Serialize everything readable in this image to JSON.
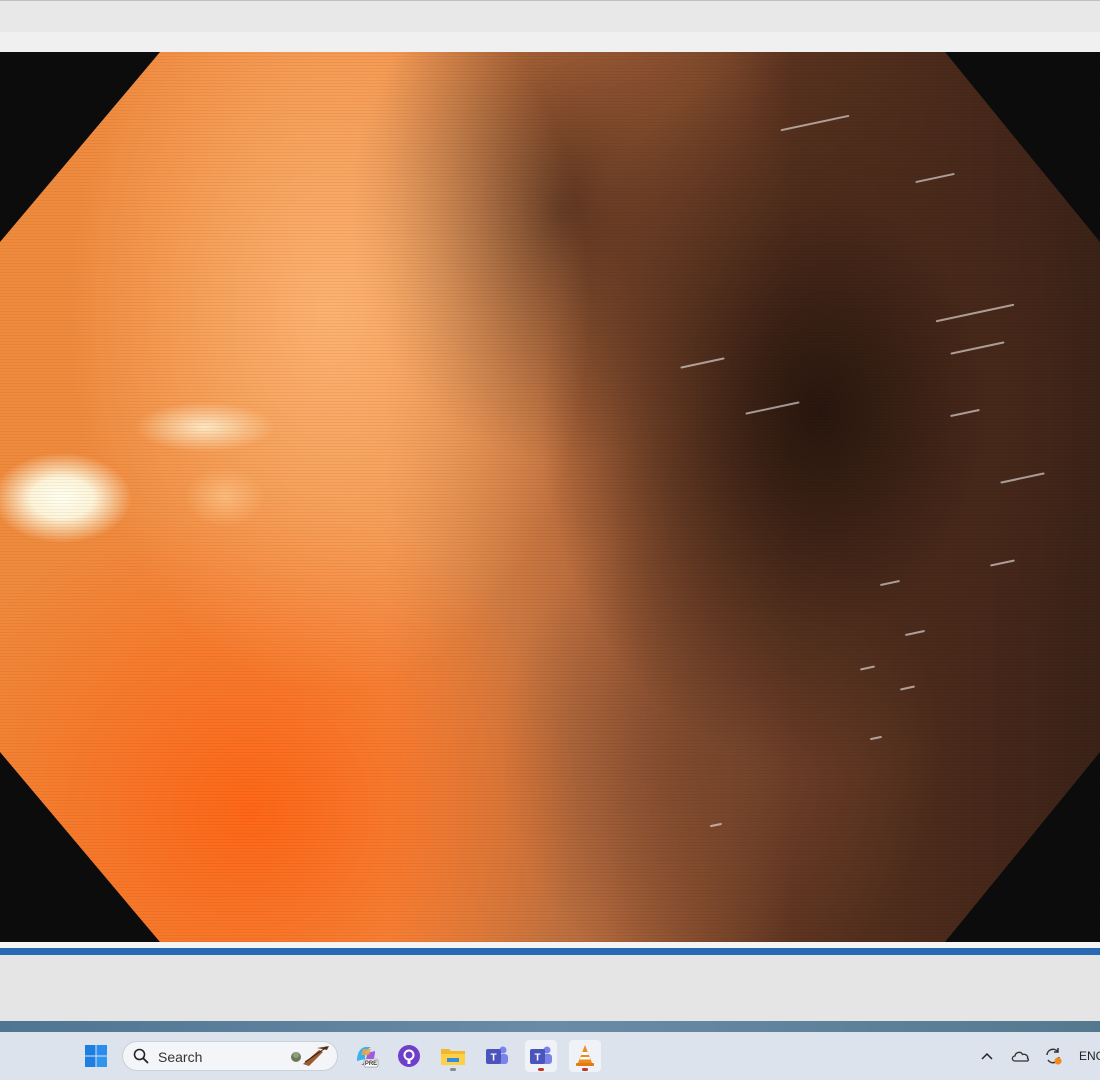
{
  "player": {
    "progress": 1.0
  },
  "taskbar": {
    "search_placeholder": "Search",
    "search_label": "Search",
    "apps": [
      {
        "name": "start",
        "icon": "windows-logo-icon"
      },
      {
        "name": "search",
        "icon": "search-icon"
      },
      {
        "name": "copilot",
        "icon": "copilot-icon",
        "badge": "PRE"
      },
      {
        "name": "github",
        "icon": "github-icon"
      },
      {
        "name": "file-explorer",
        "icon": "folder-icon"
      },
      {
        "name": "teams-work",
        "icon": "teams-icon"
      },
      {
        "name": "teams",
        "icon": "teams-icon"
      },
      {
        "name": "vlc",
        "icon": "vlc-cone-icon"
      }
    ],
    "tray": {
      "language": "ENG"
    }
  },
  "colors": {
    "seek_bar": "#2f70bd",
    "taskbar_bg": "#dce3ec",
    "vlc_orange": "#f08a1c"
  }
}
